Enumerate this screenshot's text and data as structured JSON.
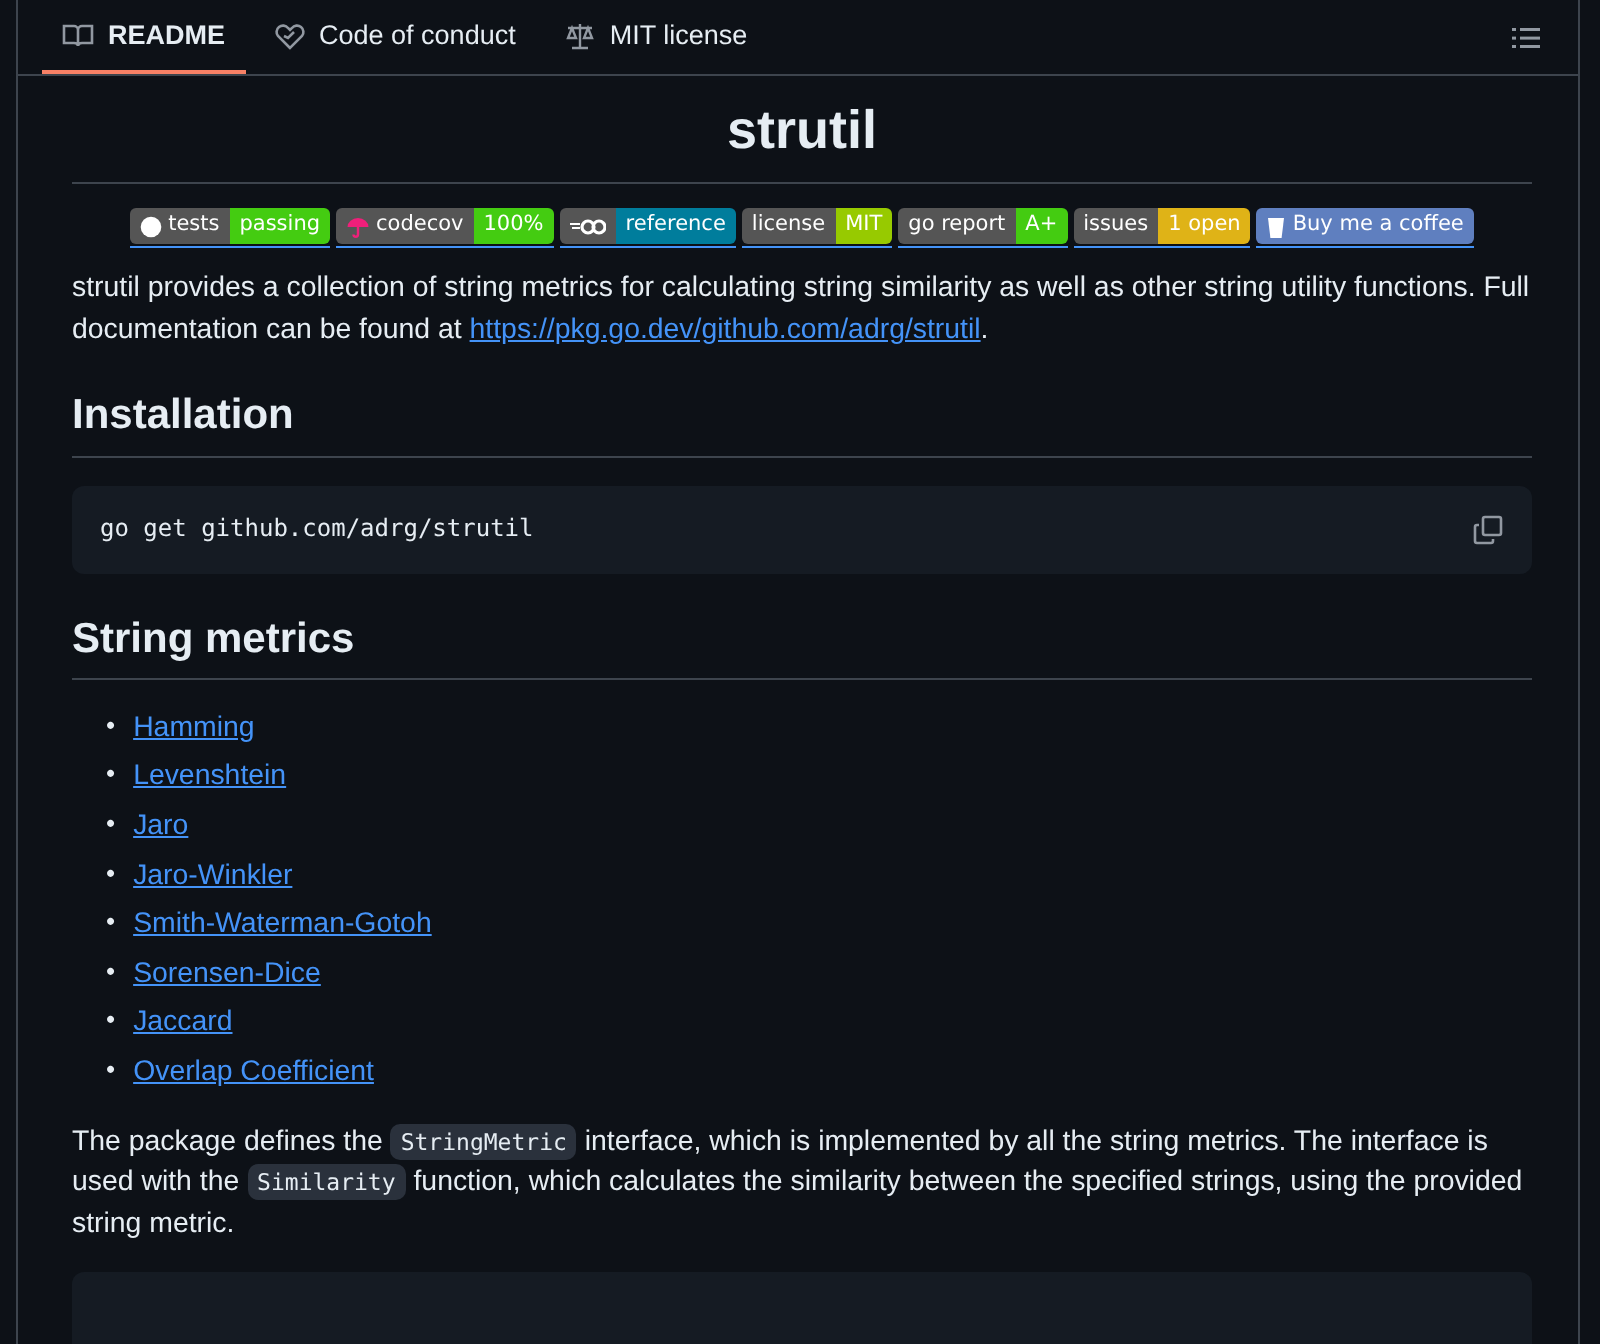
{
  "tabs": [
    {
      "label": "README",
      "selected": true
    },
    {
      "label": "Code of conduct",
      "selected": false
    },
    {
      "label": "MIT license",
      "selected": false
    }
  ],
  "title": "strutil",
  "badges": [
    {
      "label": "tests",
      "value": "passing",
      "color": "#44cc11"
    },
    {
      "label": "codecov",
      "value": "100%",
      "color": "#44cc11"
    },
    {
      "value": "reference",
      "color": "#007d9c"
    },
    {
      "label": "license",
      "value": "MIT",
      "color": "#97ca00"
    },
    {
      "label": "go report",
      "value": "A+",
      "color": "#44cc11"
    },
    {
      "label": "issues",
      "value": "1 open",
      "color": "#dfb317"
    },
    {
      "label": "Buy me a coffee",
      "color": "#5f7fbf"
    }
  ],
  "intro": {
    "text": "strutil provides a collection of string metrics for calculating string similarity as well as other string utility functions. Full documentation can be found at ",
    "link": "https://pkg.go.dev/github.com/adrg/strutil",
    "after": "."
  },
  "installation": {
    "heading": "Installation",
    "code": "go get github.com/adrg/strutil"
  },
  "metrics": {
    "heading": "String metrics",
    "items": [
      {
        "bullet": "•",
        "text": "Hamming"
      },
      {
        "bullet": "•",
        "text": "Levenshtein"
      },
      {
        "bullet": "•",
        "text": "Jaro"
      },
      {
        "bullet": "•",
        "text": "Jaro-Winkler"
      },
      {
        "bullet": "•",
        "text": "Smith-Waterman-Gotoh"
      },
      {
        "bullet": "•",
        "text": "Sorensen-Dice"
      },
      {
        "bullet": "•",
        "text": "Jaccard"
      },
      {
        "bullet": "•",
        "text": "Overlap Coefficient"
      }
    ]
  },
  "description": [
    {
      "kind": "text",
      "text": "The package defines the "
    },
    {
      "kind": "code",
      "text": "StringMetric"
    },
    {
      "kind": "text",
      "text": " interface, which is implemented by all the string metrics. The interface is used with the "
    },
    {
      "kind": "code",
      "text": "Similarity"
    },
    {
      "kind": "text",
      "text": " function, which calculates the similarity between the specified strings, using the provided string metric."
    }
  ]
}
